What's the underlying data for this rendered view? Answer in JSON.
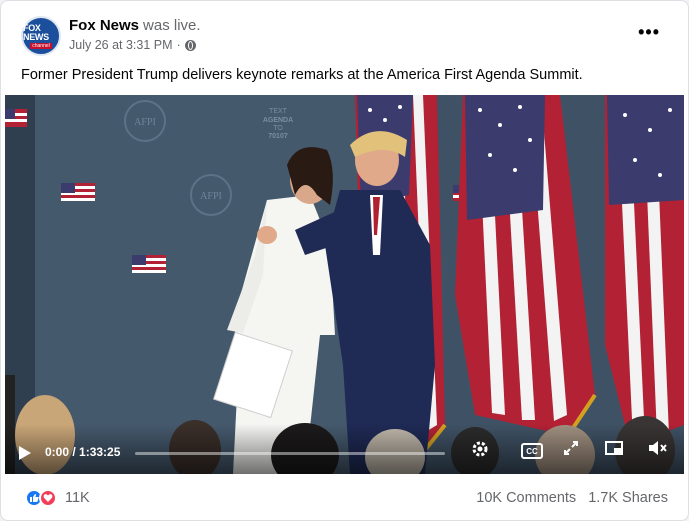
{
  "post": {
    "page_name": "Fox News",
    "status": "was live.",
    "date": "July 26 at 3:31 PM",
    "separator": "·",
    "caption": "Former President Trump delivers keynote remarks at the America First Agenda Summit.",
    "avatar_text": "FOX NEWS",
    "avatar_sub": "channel"
  },
  "video": {
    "backdrop_logo": "AFPI",
    "backdrop_text_line1": "TEXT",
    "backdrop_text_line2": "AGENDA",
    "backdrop_text_line3": "TO",
    "backdrop_text_line4": "70107",
    "time_display": "0:00 / 1:33:25",
    "progress_fraction": 0.0,
    "cc_label": "CC"
  },
  "footer": {
    "reaction_count": "11K",
    "comments": "10K Comments",
    "shares": "1.7K Shares"
  },
  "colors": {
    "facebook_blue": "#1877f2",
    "love_red": "#f33e58",
    "backdrop": "#3c4f63"
  }
}
